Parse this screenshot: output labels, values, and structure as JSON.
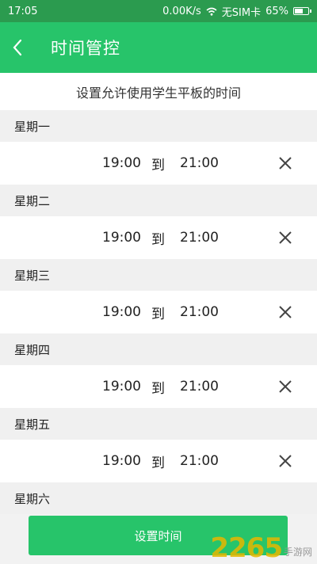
{
  "status_bar": {
    "time": "17:05",
    "speed": "0.00K/s",
    "carrier": "无SIM卡",
    "battery": "65%",
    "battery_level": 0.65
  },
  "app_bar": {
    "title": "时间管控",
    "back_icon": "chevron-left-icon"
  },
  "subtitle": "设置允许使用学生平板的时间",
  "days": [
    {
      "name": "星期一",
      "start": "19:00",
      "to": "到",
      "end": "21:00"
    },
    {
      "name": "星期二",
      "start": "19:00",
      "to": "到",
      "end": "21:00"
    },
    {
      "name": "星期三",
      "start": "19:00",
      "to": "到",
      "end": "21:00"
    },
    {
      "name": "星期四",
      "start": "19:00",
      "to": "到",
      "end": "21:00"
    },
    {
      "name": "星期五",
      "start": "19:00",
      "to": "到",
      "end": "21:00"
    },
    {
      "name": "星期六"
    }
  ],
  "bottom_button": "设置时间",
  "watermark": {
    "number": "2265",
    "text": "手游网"
  },
  "colors": {
    "status_bar": "#2b9b4f",
    "primary": "#27c46a",
    "section_bg": "#f0f0f0"
  }
}
